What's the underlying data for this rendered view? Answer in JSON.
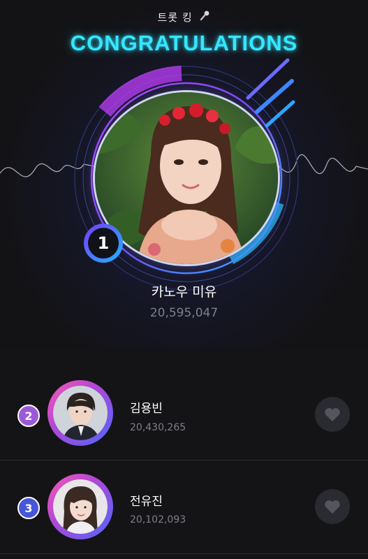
{
  "header": {
    "subtitle": "트롯 킹",
    "subtitle_icon": "microphone-icon",
    "title": "CONGRATULATIONS"
  },
  "winner": {
    "rank": "1",
    "name": "카노우 미유",
    "score": "20,595,047"
  },
  "ranking": [
    {
      "rank": "2",
      "name": "김용빈",
      "score": "20,430,265",
      "rank_color": "#9a5ad8",
      "action_icon": "heart-icon"
    },
    {
      "rank": "3",
      "name": "전유진",
      "score": "20,102,093",
      "rank_color": "#4656d8",
      "action_icon": "heart-icon"
    }
  ],
  "colors": {
    "background": "#141416",
    "title_glow": "#35e6ff",
    "ring_gradient": [
      "#ff5ab3",
      "#6f5cf0"
    ],
    "secondary_text": "#7d7f88"
  }
}
